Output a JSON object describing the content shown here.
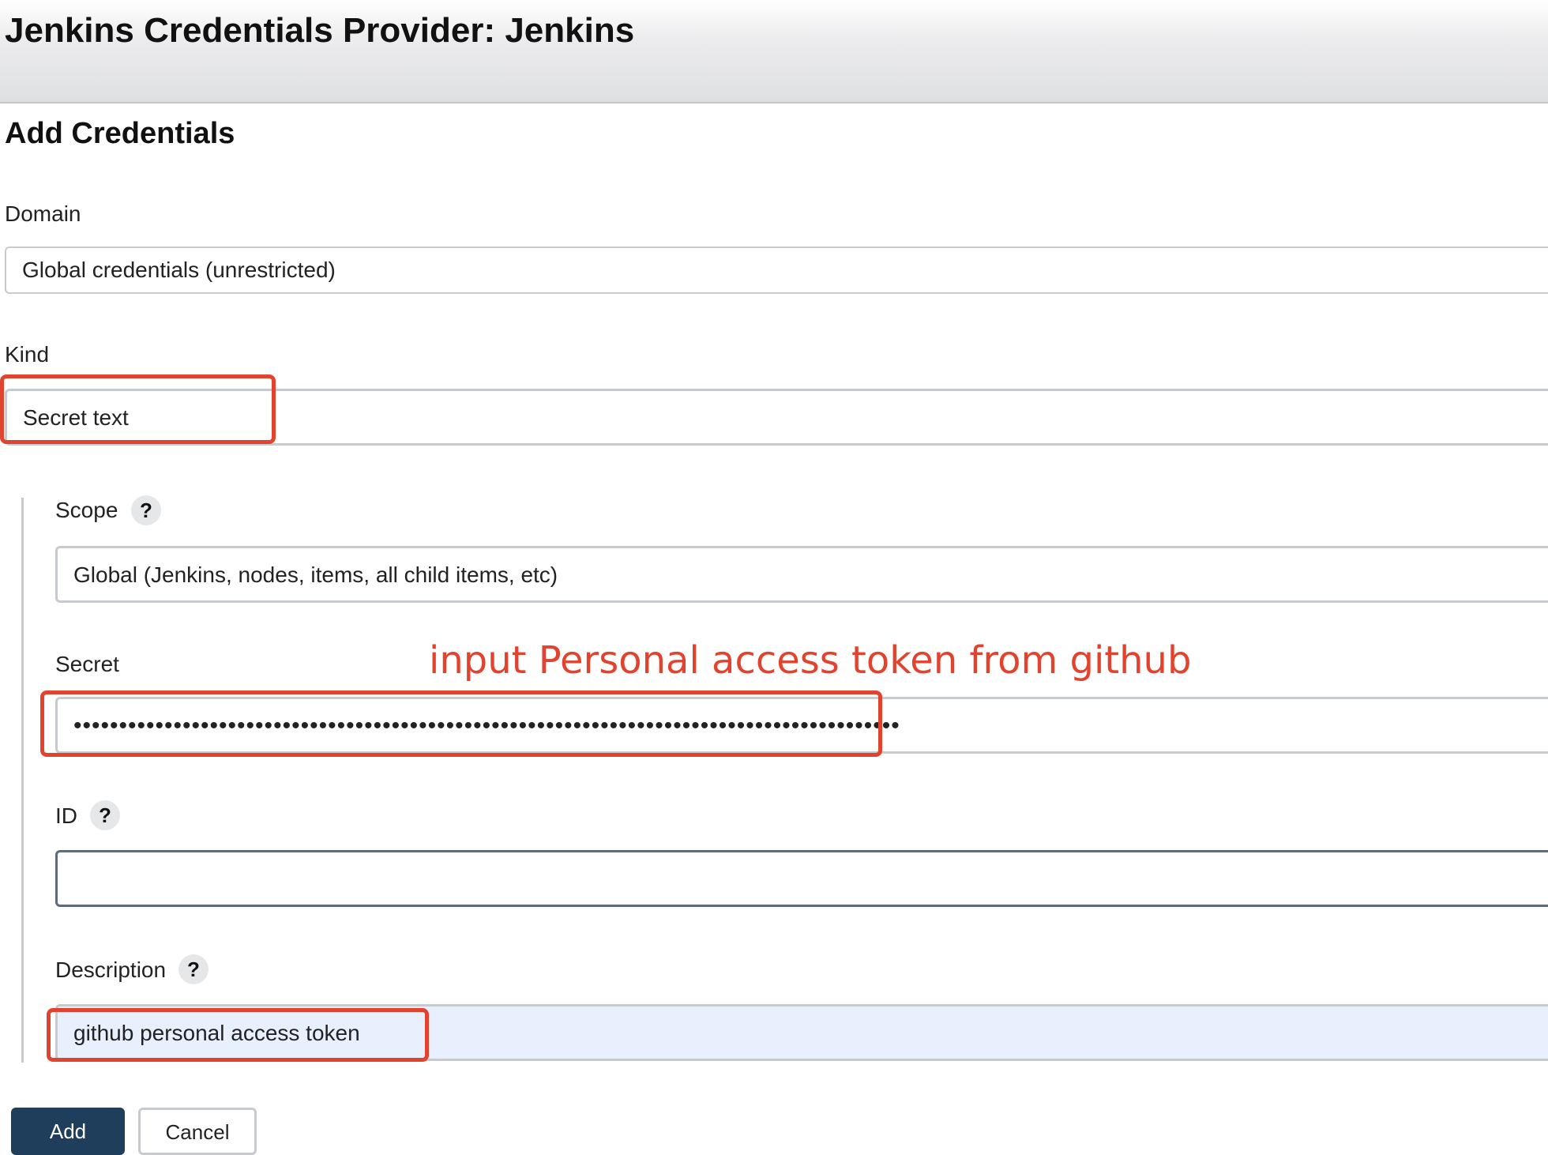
{
  "header": {
    "title": "Jenkins Credentials Provider: Jenkins"
  },
  "form": {
    "title": "Add Credentials",
    "domain": {
      "label": "Domain",
      "value": "Global credentials (unrestricted)"
    },
    "kind": {
      "label": "Kind",
      "value": "Secret text"
    },
    "scope": {
      "label": "Scope",
      "help": "?",
      "value": "Global (Jenkins, nodes, items, all child items, etc)"
    },
    "secret": {
      "label": "Secret",
      "value": "•••••••••••••••••••••••••••••••••••••••••••••••••••••••••••••••••••••••••••••••••••••••••••"
    },
    "id": {
      "label": "ID",
      "help": "?",
      "value": ""
    },
    "description": {
      "label": "Description",
      "help": "?",
      "value": "github personal access token"
    }
  },
  "annotation": {
    "text": "input Personal access token from github",
    "color": "#e2432e"
  },
  "buttons": {
    "add": "Add",
    "cancel": "Cancel"
  },
  "colors": {
    "primary_button": "#1f3e5b",
    "autofill_bg": "#e8f0fd",
    "highlight": "#e2432e"
  }
}
